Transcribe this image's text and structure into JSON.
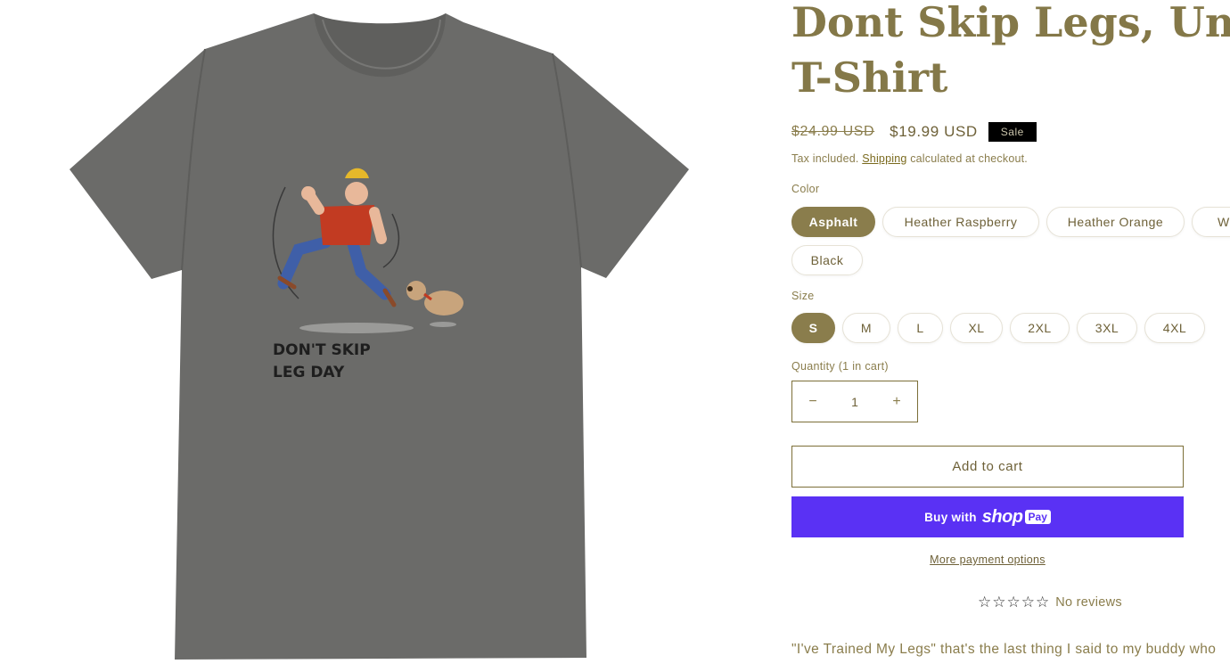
{
  "product": {
    "title_line1": "Dont Skip Legs, Unise",
    "title_line2": "T-Shirt",
    "price_regular": "$24.99 USD",
    "price_sale": "$19.99 USD",
    "sale_badge": "Sale",
    "tax_prefix": "Tax included.",
    "tax_link": "Shipping",
    "tax_suffix": "calculated at checkout."
  },
  "image": {
    "print_line1": "DON'T SKIP",
    "print_line2": "LEG DAY",
    "shirt_color": "#6b6b69"
  },
  "color": {
    "label": "Color",
    "options": [
      "Asphalt",
      "Heather Raspberry",
      "Heather Orange",
      "Wh",
      "Black"
    ],
    "selected": "Asphalt"
  },
  "size": {
    "label": "Size",
    "options": [
      "S",
      "M",
      "L",
      "XL",
      "2XL",
      "3XL",
      "4XL"
    ],
    "selected": "S"
  },
  "quantity": {
    "label": "Quantity (1 in cart)",
    "value": "1",
    "decrease": "−",
    "increase": "+"
  },
  "buttons": {
    "add_to_cart": "Add to cart",
    "buy_with": "Buy with",
    "shop": "shop",
    "pay": "Pay",
    "more_payment": "More payment options"
  },
  "reviews": {
    "stars": "☆☆☆☆☆",
    "text": "No reviews"
  },
  "description": "\"I've Trained My Legs\" that's the last thing I said to my buddy who",
  "colors": {
    "accent": "#8a7d4c",
    "title": "#847848",
    "shop_pay": "#5a31f4"
  }
}
